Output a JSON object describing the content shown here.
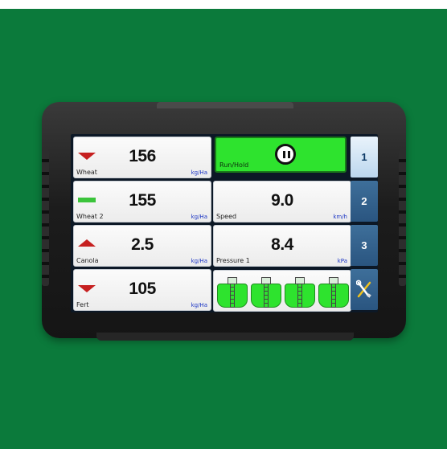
{
  "rows": [
    {
      "name": "Wheat",
      "value": "156",
      "unit": "kg/Ha",
      "indicator": "down"
    },
    {
      "name": "Wheat 2",
      "value": "155",
      "unit": "kg/Ha",
      "indicator": "flat"
    },
    {
      "name": "Canola",
      "value": "2.5",
      "unit": "kg/Ha",
      "indicator": "up"
    },
    {
      "name": "Fert",
      "value": "105",
      "unit": "kg/Ha",
      "indicator": "down"
    }
  ],
  "run_hold": {
    "label": "Run/Hold",
    "state": "paused"
  },
  "speed": {
    "name": "Speed",
    "value": "9.0",
    "unit": "km/h"
  },
  "pressure": {
    "name": "Pressure 1",
    "value": "8.4",
    "unit": "kPa"
  },
  "tanks": {
    "count": 4,
    "fill_color": "#2ee32e"
  },
  "tabs": [
    {
      "label": "1",
      "active": true
    },
    {
      "label": "2",
      "active": false
    },
    {
      "label": "3",
      "active": false
    }
  ],
  "tools_tab": {
    "icon": "wrench-screwdriver-icon"
  },
  "colors": {
    "background": "#0b7a3b",
    "run_green": "#2ee32e",
    "indicator_red": "#c62020",
    "indicator_green": "#3bc43b",
    "tab_blue": "#2a5580",
    "unit_blue": "#1a34c4"
  }
}
